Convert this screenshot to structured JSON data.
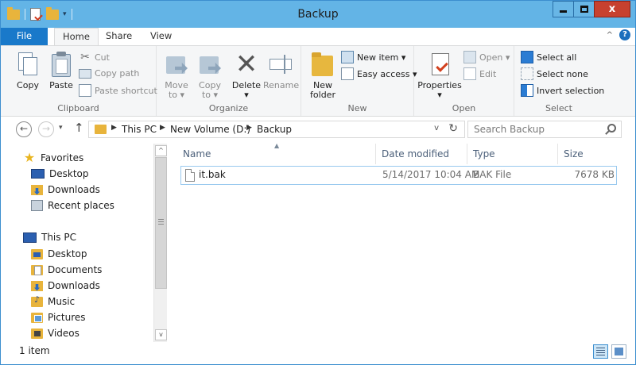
{
  "window": {
    "title": "Backup",
    "quick_access_dropdown": "▾",
    "close_glyph": "x"
  },
  "ribbon_tabs": [
    {
      "label": "File"
    },
    {
      "label": "Home"
    },
    {
      "label": "Share"
    },
    {
      "label": "View"
    }
  ],
  "help": {
    "glyph": "?",
    "collapse_glyph": "^"
  },
  "ribbon": {
    "clipboard": {
      "label": "Clipboard",
      "copy": "Copy",
      "paste": "Paste",
      "cut": "Cut",
      "copy_path": "Copy path",
      "paste_shortcut": "Paste shortcut"
    },
    "organize": {
      "label": "Organize",
      "move_to": "Move",
      "move_to_2": "to ▾",
      "copy_to": "Copy",
      "copy_to_2": "to ▾",
      "delete": "Delete",
      "delete_2": "▾",
      "rename": "Rename"
    },
    "new": {
      "label": "New",
      "new_folder": "New",
      "new_folder_2": "folder",
      "new_item": "New item ▾",
      "easy_access": "Easy access ▾"
    },
    "open": {
      "label": "Open",
      "properties": "Properties",
      "properties_2": "▾",
      "open": "Open ▾",
      "edit": "Edit"
    },
    "select": {
      "label": "Select",
      "select_all": "Select all",
      "select_none": "Select none",
      "invert_selection": "Invert selection"
    }
  },
  "address_bar": {
    "breadcrumbs": [
      "This PC",
      "New Volume (D:)",
      "Backup"
    ],
    "separator": "▶",
    "dropdown": "v",
    "refresh": "↻"
  },
  "search": {
    "placeholder": "Search Backup"
  },
  "navigation": {
    "back": "←",
    "forward": "→",
    "recent": "▾",
    "up": "↑"
  },
  "nav_pane": {
    "favorites": {
      "label": "Favorites",
      "items": [
        {
          "label": "Desktop",
          "icon": "desktop-icon"
        },
        {
          "label": "Downloads",
          "icon": "downloads-icon"
        },
        {
          "label": "Recent places",
          "icon": "recent-places-icon"
        }
      ]
    },
    "this_pc": {
      "label": "This PC",
      "items": [
        {
          "label": "Desktop",
          "icon": "desktop-folder-icon"
        },
        {
          "label": "Documents",
          "icon": "documents-icon"
        },
        {
          "label": "Downloads",
          "icon": "downloads-icon"
        },
        {
          "label": "Music",
          "icon": "music-icon"
        },
        {
          "label": "Pictures",
          "icon": "pictures-icon"
        },
        {
          "label": "Videos",
          "icon": "videos-icon"
        }
      ]
    }
  },
  "scrollbar": {
    "up": "^",
    "down": "v"
  },
  "file_list": {
    "columns": {
      "name": "Name",
      "date_modified": "Date modified",
      "type": "Type",
      "size": "Size"
    },
    "sort_indicator": "▲",
    "rows": [
      {
        "name": "it.bak",
        "date_modified": "5/14/2017 10:04 AM",
        "type": "BAK File",
        "size": "7678 KB"
      }
    ]
  },
  "status_bar": {
    "item_count": "1 item"
  },
  "colors": {
    "titlebar": "#63b4e6",
    "file_tab": "#1979ca",
    "close_button": "#c7412f",
    "folder": "#e8b43c"
  }
}
